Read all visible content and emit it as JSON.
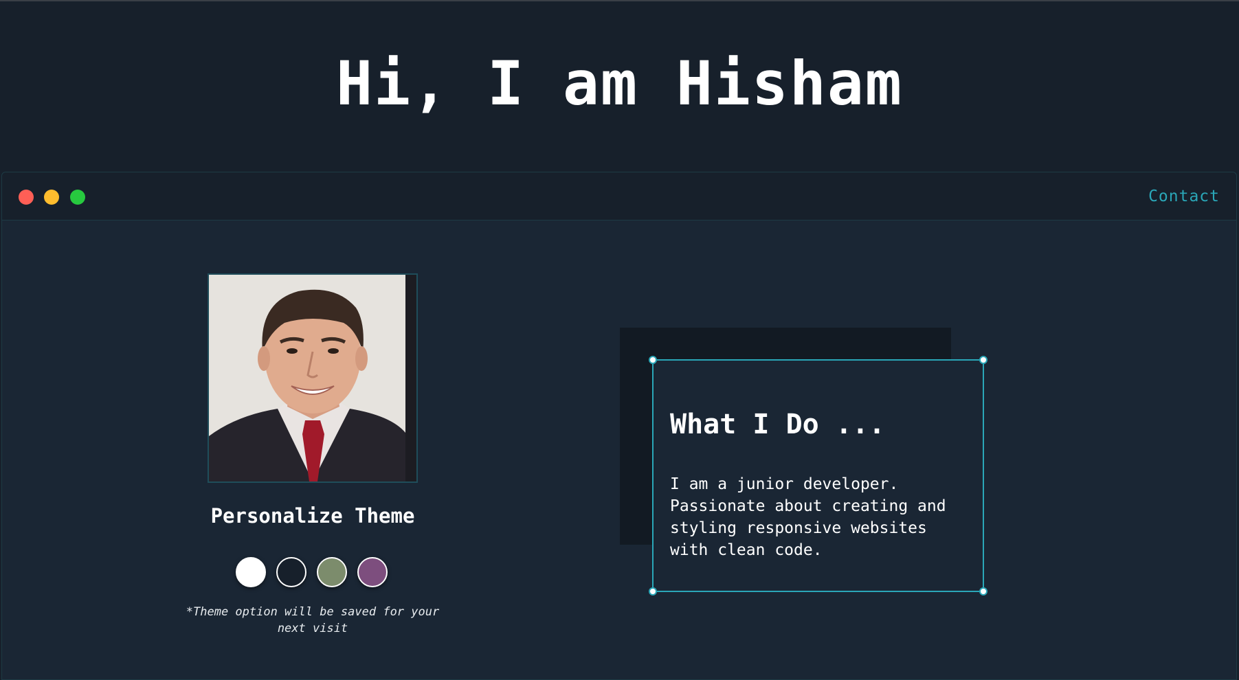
{
  "hero": {
    "title": "Hi, I am Hisham"
  },
  "window": {
    "controls": [
      {
        "name": "close-control",
        "color": "#ff5f56"
      },
      {
        "name": "minimize-control",
        "color": "#ffbd2e"
      },
      {
        "name": "maximize-control",
        "color": "#27c93f"
      }
    ],
    "contact_label": "Contact",
    "accent": "#2aa7b8"
  },
  "profile": {
    "personalize_title": "Personalize Theme",
    "theme_note": "*Theme option will be saved for your next visit",
    "swatches": [
      {
        "name": "theme-swatch-light",
        "fill": "#ffffff",
        "border": "#ffffff"
      },
      {
        "name": "theme-swatch-dark",
        "fill": "#17202b",
        "border": "#ffffff"
      },
      {
        "name": "theme-swatch-green",
        "fill": "#7c8c6c",
        "border": "#ffffff"
      },
      {
        "name": "theme-swatch-purple",
        "fill": "#7d4e7e",
        "border": "#ffffff"
      }
    ]
  },
  "about": {
    "title": "What I Do ...",
    "body": "I am a junior developer.\nPassionate about creating and\nstyling responsive websites\nwith clean code."
  }
}
